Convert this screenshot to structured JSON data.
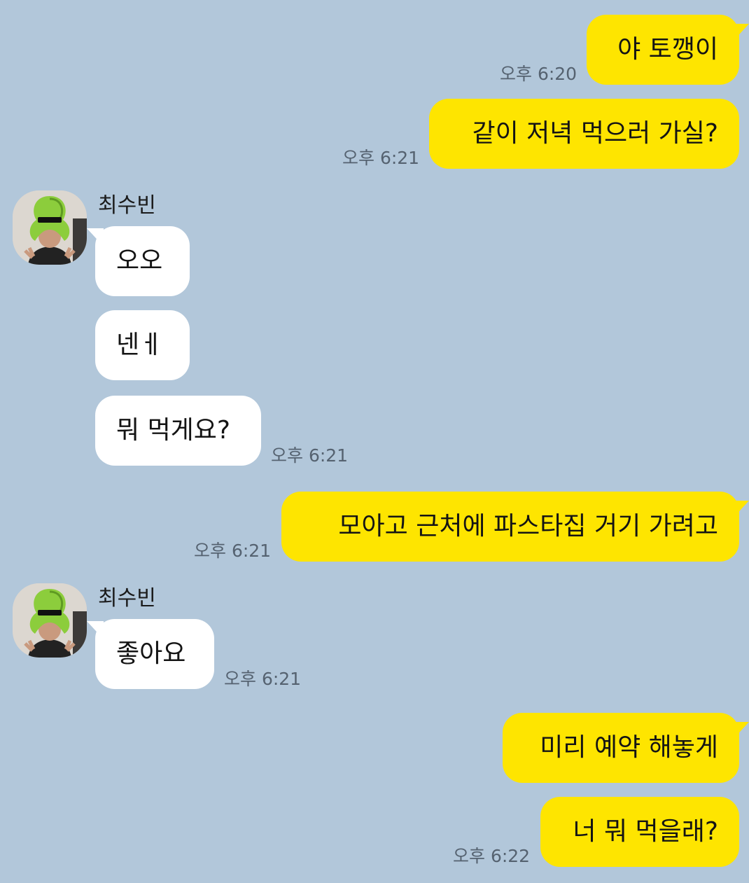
{
  "contact": {
    "name": "최수빈",
    "avatar_icon": "green-hat-person-avatar-icon"
  },
  "colors": {
    "background": "#b2c7da",
    "my_bubble": "#fee500",
    "their_bubble": "#ffffff",
    "timestamp": "#556270"
  },
  "messages": [
    {
      "sender": "me",
      "text": "야 토깽이",
      "time": "오후 6:20"
    },
    {
      "sender": "me",
      "text": "같이 저녁 먹으러 가실?",
      "time": "오후 6:21"
    },
    {
      "sender": "other",
      "text": "오오",
      "time": ""
    },
    {
      "sender": "other",
      "text": "넨ㅔ",
      "time": ""
    },
    {
      "sender": "other",
      "text": "뭐 먹게요?",
      "time": "오후 6:21"
    },
    {
      "sender": "me",
      "text": "모아고 근처에 파스타집 거기 가려고",
      "time": "오후 6:21"
    },
    {
      "sender": "other",
      "text": "좋아요",
      "time": "오후 6:21"
    },
    {
      "sender": "me",
      "text": "미리 예약 해놓게",
      "time": ""
    },
    {
      "sender": "me",
      "text": "너 뭐 먹을래?",
      "time": "오후 6:22"
    }
  ]
}
